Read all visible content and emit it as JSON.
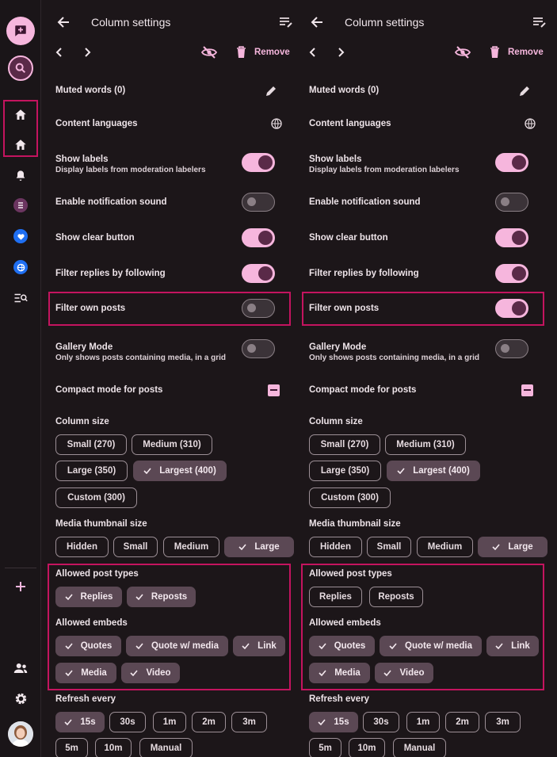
{
  "colors": {
    "accent": "#f6b6dd",
    "highlight": "#c4145f",
    "chip_selected": "#5b4854",
    "background": "#1c1619"
  },
  "rail": {
    "items": [
      "compose-icon",
      "search-icon",
      "home-icon",
      "home-icon",
      "notifications-icon",
      "list-feed-icon",
      "heart-feed-icon",
      "globe-feed-icon",
      "search-list-icon",
      "add-icon",
      "people-icon",
      "settings-icon",
      "avatar"
    ]
  },
  "columns": [
    {
      "header": {
        "title": "Column settings",
        "remove_label": "Remove"
      },
      "rows": {
        "muted_words": "Muted words (0)",
        "content_languages": "Content languages",
        "show_labels": "Show labels",
        "show_labels_sub": "Display labels from moderation labelers",
        "notification_sound": "Enable notification sound",
        "clear_button": "Show clear button",
        "filter_replies": "Filter replies by following",
        "filter_own": "Filter own posts",
        "gallery": "Gallery Mode",
        "gallery_sub": "Only shows posts containing media, in a grid",
        "compact": "Compact mode for posts"
      },
      "toggles": {
        "show_labels": true,
        "notification_sound": false,
        "clear_button": true,
        "filter_replies": true,
        "filter_own": false,
        "gallery": false
      },
      "column_size": {
        "label": "Column size",
        "options": [
          "Small (270)",
          "Medium (310)",
          "Large (350)",
          "Largest (400)",
          "Custom (300)"
        ],
        "selected": "Largest (400)"
      },
      "thumb": {
        "label": "Media thumbnail size",
        "options": [
          "Hidden",
          "Small",
          "Medium",
          "Large"
        ],
        "selected": "Large"
      },
      "post_types": {
        "label": "Allowed post types",
        "options": [
          "Replies",
          "Reposts"
        ],
        "selected": [
          "Replies",
          "Reposts"
        ]
      },
      "embeds": {
        "label": "Allowed embeds",
        "options": [
          "Quotes",
          "Quote w/ media",
          "Link",
          "Media",
          "Video"
        ],
        "selected": [
          "Quotes",
          "Quote w/ media",
          "Link",
          "Media",
          "Video"
        ]
      },
      "refresh": {
        "label": "Refresh every",
        "options": [
          "15s",
          "30s",
          "1m",
          "2m",
          "3m",
          "5m",
          "10m",
          "Manual"
        ],
        "selected": "15s"
      }
    },
    {
      "header": {
        "title": "Column settings",
        "remove_label": "Remove"
      },
      "rows": {
        "muted_words": "Muted words (0)",
        "content_languages": "Content languages",
        "show_labels": "Show labels",
        "show_labels_sub": "Display labels from moderation labelers",
        "notification_sound": "Enable notification sound",
        "clear_button": "Show clear button",
        "filter_replies": "Filter replies by following",
        "filter_own": "Filter own posts",
        "gallery": "Gallery Mode",
        "gallery_sub": "Only shows posts containing media, in a grid",
        "compact": "Compact mode for posts"
      },
      "toggles": {
        "show_labels": true,
        "notification_sound": false,
        "clear_button": true,
        "filter_replies": true,
        "filter_own": true,
        "gallery": false
      },
      "column_size": {
        "label": "Column size",
        "options": [
          "Small (270)",
          "Medium (310)",
          "Large (350)",
          "Largest (400)",
          "Custom (300)"
        ],
        "selected": "Largest (400)"
      },
      "thumb": {
        "label": "Media thumbnail size",
        "options": [
          "Hidden",
          "Small",
          "Medium",
          "Large"
        ],
        "selected": "Large"
      },
      "post_types": {
        "label": "Allowed post types",
        "options": [
          "Replies",
          "Reposts"
        ],
        "selected": []
      },
      "embeds": {
        "label": "Allowed embeds",
        "options": [
          "Quotes",
          "Quote w/ media",
          "Link",
          "Media",
          "Video"
        ],
        "selected": [
          "Quotes",
          "Quote w/ media",
          "Link",
          "Media",
          "Video"
        ]
      },
      "refresh": {
        "label": "Refresh every",
        "options": [
          "15s",
          "30s",
          "1m",
          "2m",
          "3m",
          "5m",
          "10m",
          "Manual"
        ],
        "selected": "15s"
      }
    }
  ]
}
